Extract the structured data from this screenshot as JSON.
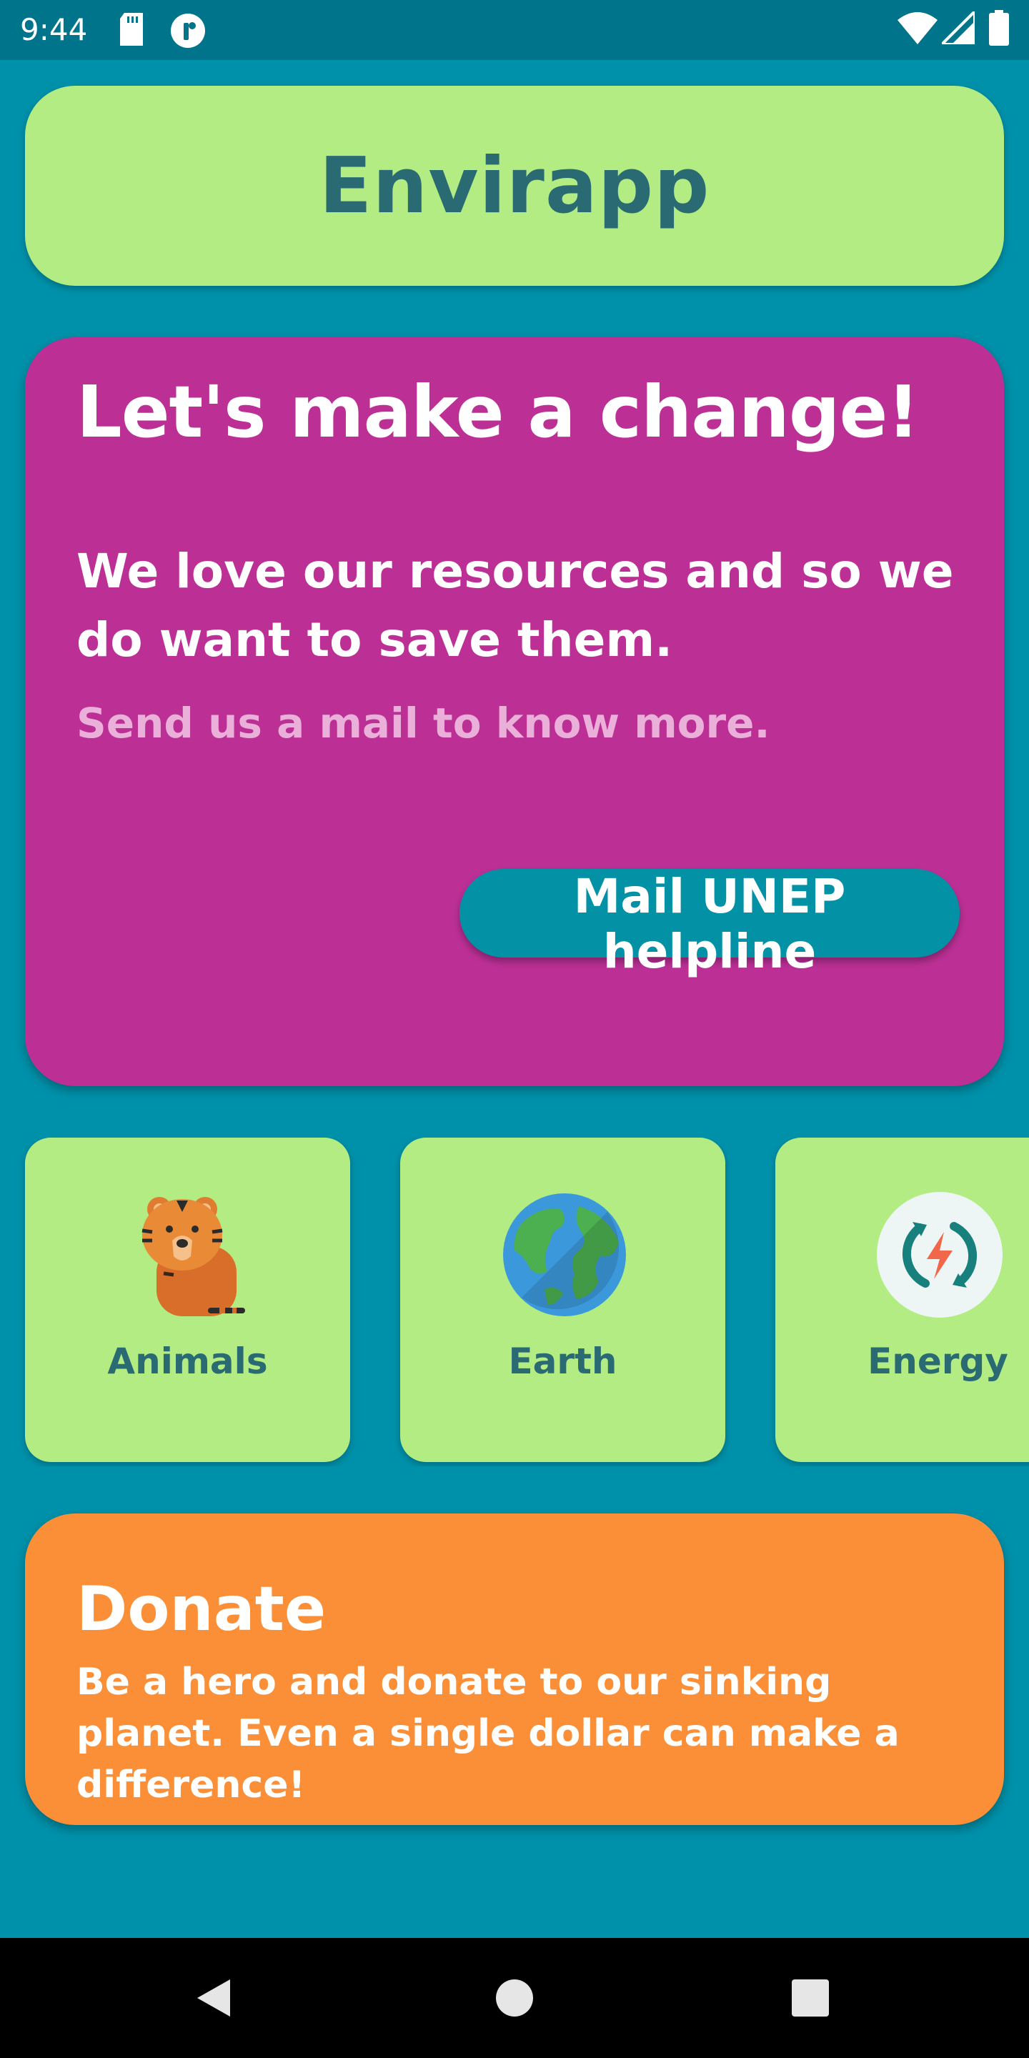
{
  "status_bar": {
    "time": "9:44",
    "icons": [
      "sd-card-icon",
      "app-notification-icon",
      "wifi-icon",
      "signal-icon",
      "battery-icon"
    ]
  },
  "header": {
    "title": "Envirapp"
  },
  "hero": {
    "headline": "Let's make a change!",
    "body": "We love our resources and so we do want to save them.",
    "subtext": "Send us a mail to know more.",
    "button_label": "Mail UNEP helpline"
  },
  "categories": [
    {
      "label": "Animals",
      "icon": "tiger-icon"
    },
    {
      "label": "Earth",
      "icon": "globe-icon"
    },
    {
      "label": "Energy",
      "icon": "energy-icon"
    }
  ],
  "donate": {
    "title": "Donate",
    "text": "Be a hero and donate to our sinking planet. Even a single dollar can make a difference!"
  },
  "nav": {
    "icons": [
      "back-icon",
      "home-icon",
      "recents-icon"
    ]
  },
  "colors": {
    "background": "#0091AA",
    "status_bar": "#00748A",
    "header_card": "#B3EC82",
    "hero_card": "#BC3096",
    "button": "#0391A6",
    "donate_card": "#FB8F38",
    "title_text": "#2A6B73"
  }
}
